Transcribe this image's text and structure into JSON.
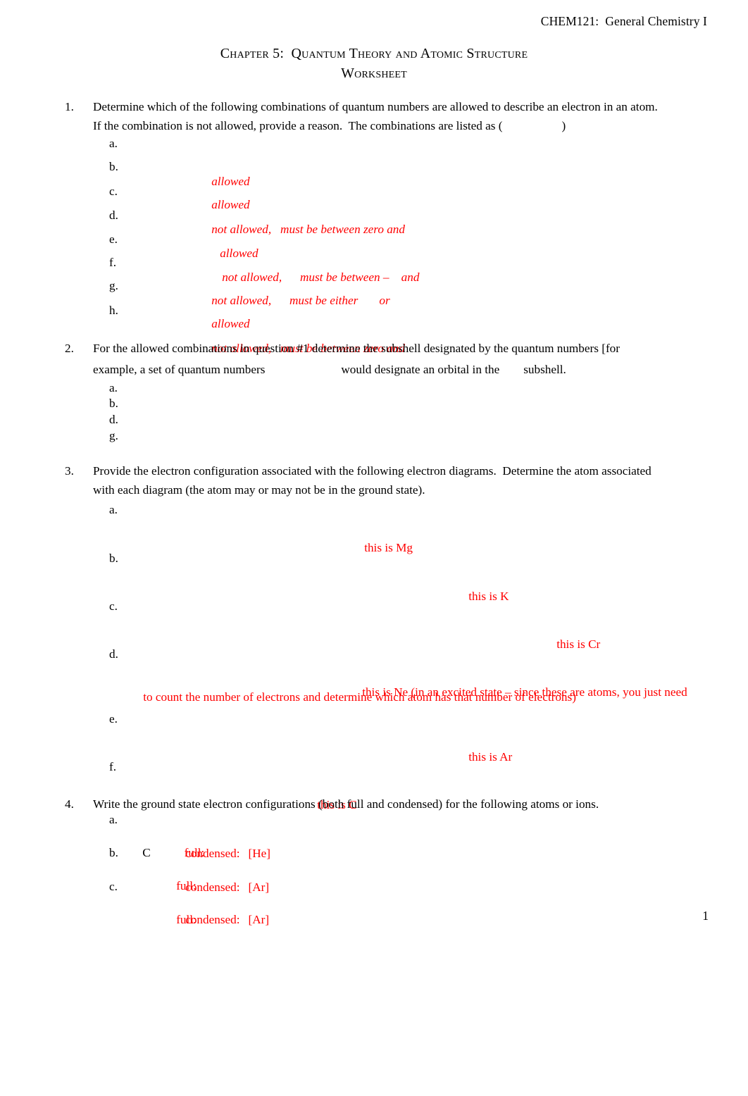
{
  "header": {
    "course": "CHEM121:  General Chemistry I"
  },
  "title": {
    "line1": "Chapter 5:  Quantum Theory and Atomic Structure",
    "line2": "Worksheet"
  },
  "questions": [
    {
      "number": "1.",
      "text_line1": "Determine which of the following combinations of quantum numbers are allowed to describe an electron in an atom.",
      "text_line2_pre": "If the combination is not allowed, provide a reason.  The combinations are listed as (",
      "text_line2_post": ")",
      "items": [
        {
          "letter": "a.",
          "answer": "allowed"
        },
        {
          "letter": "b.",
          "answer": "allowed"
        },
        {
          "letter": "c.",
          "answer": "not allowed,   must be between zero and"
        },
        {
          "letter": "d.",
          "answer": "allowed"
        },
        {
          "letter": "e.",
          "answer": "not allowed,      must be between –    and"
        },
        {
          "letter": "f.",
          "answer": "not allowed,      must be either       or"
        },
        {
          "letter": "g.",
          "answer": "allowed"
        },
        {
          "letter": "h.",
          "answer": "not allowed,   must be between zero and"
        }
      ]
    },
    {
      "number": "2.",
      "text_line1": "For the allowed combinations in question #1 determine the subshell designated by the quantum numbers [for",
      "text_line2_a": "example, a set of quantum numbers",
      "text_line2_b": "would designate an orbital in the",
      "text_line2_c": "subshell.",
      "items": [
        {
          "letter": "a.",
          "answer": ""
        },
        {
          "letter": "b.",
          "answer": ""
        },
        {
          "letter": "d.",
          "answer": ""
        },
        {
          "letter": "g.",
          "answer": ""
        }
      ]
    },
    {
      "number": "3.",
      "text_line1": "Provide the electron configuration associated with the following electron diagrams.  Determine the atom associated",
      "text_line2": "with each diagram (the atom may or may not be in the ground state).",
      "items": [
        {
          "letter": "a.",
          "answer": "this is Mg"
        },
        {
          "letter": "b.",
          "answer": "this is K"
        },
        {
          "letter": "c.",
          "answer": "this is Cr"
        },
        {
          "letter": "d.",
          "answer": "this is Ne (in an excited state – since these are atoms, you just need",
          "answer_cont": "to count the number of electrons and determine which atom has that number of electrons)"
        },
        {
          "letter": "e.",
          "answer": "this is Ar"
        },
        {
          "letter": "f.",
          "answer": "this is C"
        }
      ]
    },
    {
      "number": "4.",
      "text_line1": "Write the ground state electron configurations (both full and condensed) for the following atoms or ions.",
      "items": [
        {
          "letter": "a.",
          "species": "C",
          "full_label": "full:",
          "full_value": "",
          "condensed_label": "condensed:",
          "condensed_value": "[He]"
        },
        {
          "letter": "b.",
          "species": "",
          "full_label": "full:",
          "full_value": "",
          "condensed_label": "condensed:",
          "condensed_value": "[Ar]"
        },
        {
          "letter": "c.",
          "species": "",
          "full_label": "full:",
          "full_value": "",
          "condensed_label": "condensed:",
          "condensed_value": "[Ar]"
        }
      ]
    }
  ],
  "footer": {
    "page_number": "1"
  },
  "colors": {
    "answer_red": "#FF0000",
    "text_black": "#000000",
    "background": "#FFFFFF"
  }
}
